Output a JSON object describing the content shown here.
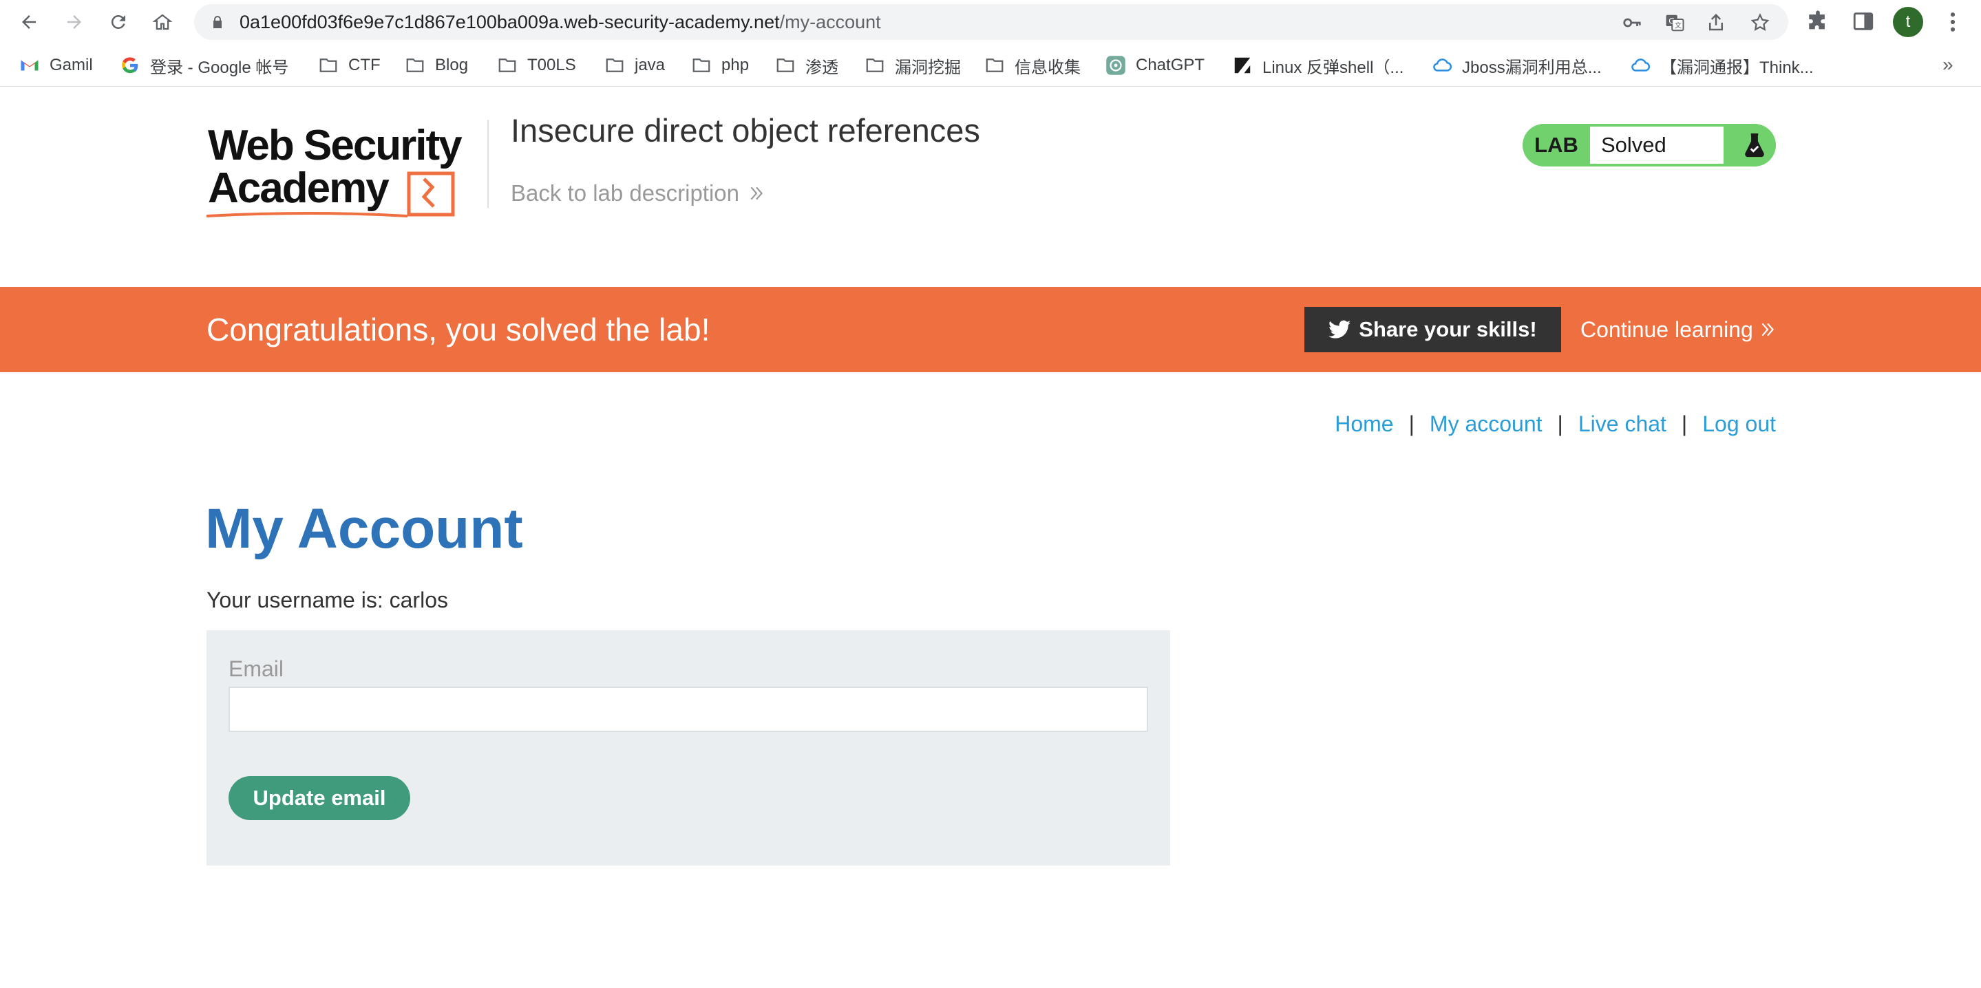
{
  "browser": {
    "url_host": "0a1e00fd03f6e9e7c1d867e100ba009a.web-security-academy.net",
    "url_path": "/my-account",
    "profile_initial": "t",
    "bookmarks": [
      {
        "label": "Gamil",
        "icon": "gmail-icon"
      },
      {
        "label": "登录 - Google 帐号",
        "icon": "google-icon"
      },
      {
        "label": "CTF",
        "icon": "folder-icon"
      },
      {
        "label": "Blog",
        "icon": "folder-icon"
      },
      {
        "label": "T00LS",
        "icon": "folder-icon"
      },
      {
        "label": "java",
        "icon": "folder-icon"
      },
      {
        "label": "php",
        "icon": "folder-icon"
      },
      {
        "label": "渗透",
        "icon": "folder-icon"
      },
      {
        "label": "漏洞挖掘",
        "icon": "folder-icon"
      },
      {
        "label": "信息收集",
        "icon": "folder-icon"
      },
      {
        "label": "ChatGPT",
        "icon": "chatgpt-icon"
      },
      {
        "label": "Linux 反弹shell（...",
        "icon": "zhihu-icon"
      },
      {
        "label": "Jboss漏洞利用总...",
        "icon": "cloud-icon"
      },
      {
        "label": "【漏洞通报】Think...",
        "icon": "cloud-icon"
      }
    ],
    "more_bookmarks": "»"
  },
  "header": {
    "logo_line1": "Web Security",
    "logo_line2": "Academy",
    "lab_title": "Insecure direct object references",
    "back_link": "Back to lab description",
    "lab_badge_label": "LAB",
    "lab_status": "Solved",
    "colors": {
      "badge_green": "#70d16d",
      "brand_orange": "#ee7040"
    }
  },
  "banner": {
    "message": "Congratulations, you solved the lab!",
    "share_label": "Share your skills!",
    "continue_label": "Continue learning"
  },
  "nav": {
    "home": "Home",
    "my_account": "My account",
    "live_chat": "Live chat",
    "log_out": "Log out",
    "separator": "|"
  },
  "main": {
    "heading": "My Account",
    "username_line": "Your username is: carlos",
    "email_label": "Email",
    "email_value": "",
    "update_button": "Update email"
  }
}
